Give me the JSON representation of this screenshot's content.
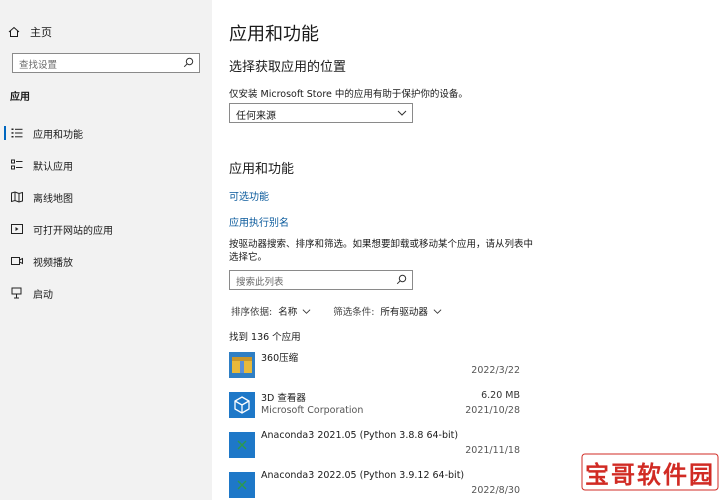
{
  "sidebar": {
    "home_label": "主页",
    "search_placeholder": "查找设置",
    "section_label": "应用",
    "items": [
      {
        "label": "应用和功能",
        "icon": "apps-features-icon",
        "active": true
      },
      {
        "label": "默认应用",
        "icon": "default-apps-icon"
      },
      {
        "label": "离线地图",
        "icon": "offline-maps-icon"
      },
      {
        "label": "可打开网站的应用",
        "icon": "apps-for-websites-icon"
      },
      {
        "label": "视频播放",
        "icon": "video-playback-icon"
      },
      {
        "label": "启动",
        "icon": "startup-icon"
      }
    ]
  },
  "main": {
    "title": "应用和功能",
    "choose_title": "选择获取应用的位置",
    "choose_desc": "仅安装 Microsoft Store 中的应用有助于保护你的设备。",
    "source_value": "任何来源",
    "section_title": "应用和功能",
    "optional_features_link": "可选功能",
    "app_alias_link": "应用执行别名",
    "search_desc": "按驱动器搜索、排序和筛选。如果想要卸载或移动某个应用，请从列表中选择它。",
    "search_placeholder": "搜索此列表",
    "sort_label": "排序依据:",
    "sort_value": "名称",
    "filter_label": "筛选条件:",
    "filter_value": "所有驱动器",
    "count_text": "找到 136 个应用",
    "apps": [
      {
        "name": "360压缩",
        "publisher": "",
        "size": "",
        "date": "2022/3/22",
        "icon": "archive-icon"
      },
      {
        "name": "3D 查看器",
        "publisher": "Microsoft Corporation",
        "size": "6.20 MB",
        "date": "2021/10/28",
        "icon": "3d-viewer-icon"
      },
      {
        "name": "Anaconda3 2021.05 (Python 3.8.8 64-bit)",
        "publisher": "",
        "size": "",
        "date": "2021/11/18",
        "icon": "installer-icon"
      },
      {
        "name": "Anaconda3 2022.05 (Python 3.9.12 64-bit)",
        "publisher": "",
        "size": "",
        "date": "2022/8/30",
        "icon": "installer-icon"
      }
    ]
  },
  "watermark": {
    "text": "宝哥软件园"
  },
  "colors": {
    "accent": "#0067c0",
    "link": "#0a5a9c",
    "sidebar_bg": "#f2f2f2",
    "app_icon_blue": "#1e78c8"
  }
}
